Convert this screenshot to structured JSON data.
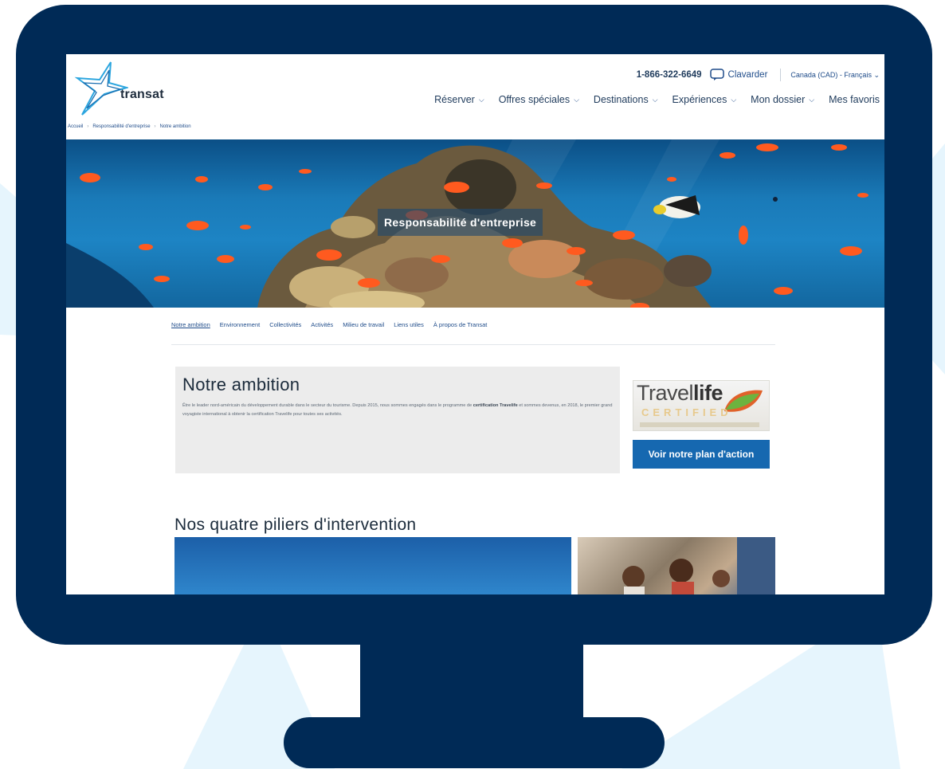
{
  "header": {
    "logo_text": "transat",
    "phone": "1-866-322-6649",
    "chat_label": "Clavarder",
    "locale": "Canada (CAD) - Français",
    "nav": [
      {
        "label": "Réserver",
        "icon": "chevron-down-icon"
      },
      {
        "label": "Offres spéciales",
        "icon": "chevron-down-icon"
      },
      {
        "label": "Destinations",
        "icon": "chevron-down-icon"
      },
      {
        "label": "Expériences",
        "icon": "chevron-down-icon"
      },
      {
        "label": "Mon dossier",
        "icon": "chevron-down-icon"
      },
      {
        "label": "Mes favoris"
      }
    ]
  },
  "breadcrumb": [
    "Accueil",
    "Responsabilité d'entreprise",
    "Notre ambition"
  ],
  "hero": {
    "title": "Responsabilité d'entreprise"
  },
  "subnav": [
    "Notre ambition",
    "Environnement",
    "Collectivités",
    "Activités",
    "Milieu de travail",
    "Liens utiles",
    "À propos de Transat"
  ],
  "ambition": {
    "title": "Notre ambition",
    "text_1": "Être le leader nord-américain du développement durable dans le secteur du tourisme. Depuis 2015, nous sommes engagés dans le programme de ",
    "text_bold": "certification Travelife",
    "text_2": " et sommes devenus, en 2018, le premier grand voyagiste international à obtenir la certification Travelife pour toutes ses activités."
  },
  "travelife": {
    "word_light": "Travel",
    "word_bold": "life",
    "certified": "CERTIFIED"
  },
  "action_button": "Voir notre plan d'action",
  "pillars": {
    "title": "Nos quatre piliers d'intervention"
  },
  "colors": {
    "navy": "#002a56",
    "accent_blue": "#1668b0",
    "bg_star": "#e6f5fd"
  }
}
